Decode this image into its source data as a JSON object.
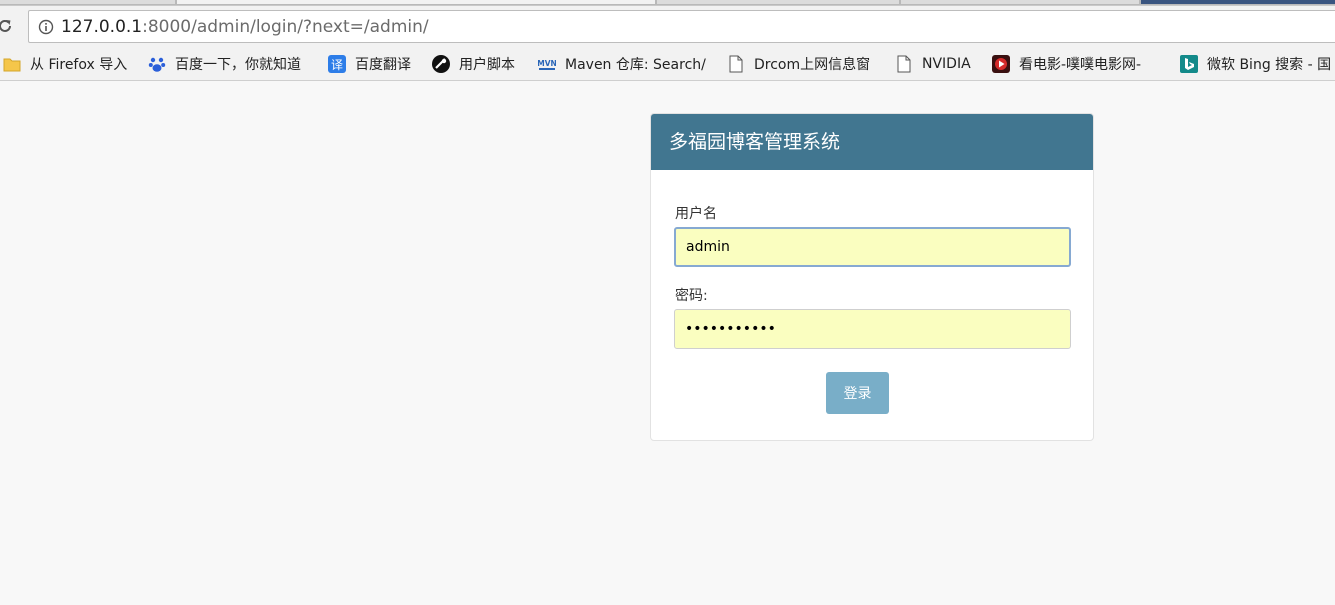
{
  "browser": {
    "url_host": "127.0.0.1",
    "url_rest": ":8000/admin/login/?next=/admin/",
    "bookmarks": [
      {
        "label": "从 Firefox 导入",
        "icon": "folder-icon"
      },
      {
        "label": "百度一下，你就知道",
        "icon": "baidu-paw-icon"
      },
      {
        "label": "百度翻译",
        "icon": "translate-icon"
      },
      {
        "label": "用户脚本",
        "icon": "userscript-icon"
      },
      {
        "label": "Maven 仓库: Search/",
        "icon": "maven-icon"
      },
      {
        "label": "Drcom上网信息窗",
        "icon": "page-icon"
      },
      {
        "label": "NVIDIA",
        "icon": "page-icon"
      },
      {
        "label": "看电影-噗噗电影网-B",
        "icon": "movie-icon"
      },
      {
        "label": "微软 Bing 搜索 - 国",
        "icon": "bing-icon"
      }
    ]
  },
  "login": {
    "title": "多福园博客管理系统",
    "username_label": "用户名",
    "username_value": "admin",
    "password_label": "密码:",
    "password_value": "•••••••••••",
    "submit_label": "登录"
  },
  "colors": {
    "header": "#417690",
    "button": "#79aec8",
    "autofill": "#fafec0",
    "page_bg": "#f8f8f8"
  }
}
